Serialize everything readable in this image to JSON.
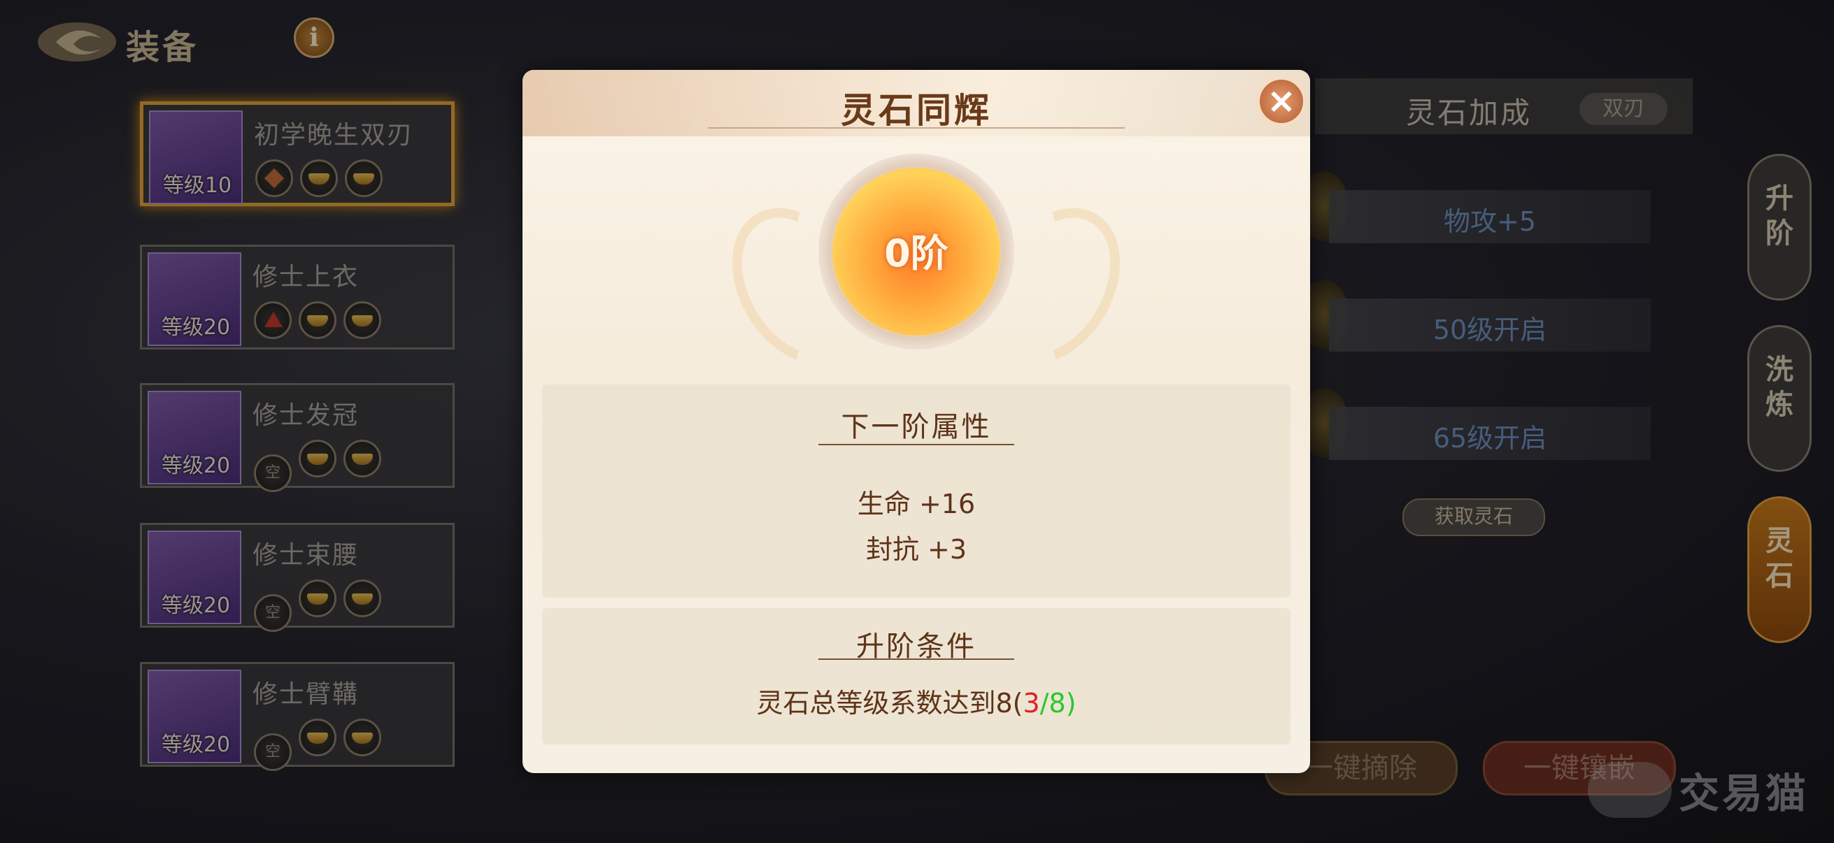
{
  "header": {
    "title": "装备",
    "info_label": "i"
  },
  "equipment": [
    {
      "name": "初学晚生双刃",
      "level": "等级10",
      "selected": true,
      "slots": [
        "diamond",
        "gold",
        "gold"
      ]
    },
    {
      "name": "修士上衣",
      "level": "等级20",
      "selected": false,
      "slots": [
        "tri",
        "gold",
        "gold"
      ]
    },
    {
      "name": "修士发冠",
      "level": "等级20",
      "selected": false,
      "slots": [
        "空",
        "gold",
        "gold"
      ]
    },
    {
      "name": "修士束腰",
      "level": "等级20",
      "selected": false,
      "slots": [
        "空",
        "gold",
        "gold"
      ]
    },
    {
      "name": "修士臂鞲",
      "level": "等级20",
      "selected": false,
      "slots": [
        "空",
        "gold",
        "gold"
      ]
    }
  ],
  "right_panel": {
    "title": "灵石加成",
    "weapon_tag": "双刃",
    "rows": [
      "物攻+5",
      "50级开启",
      "65级开启"
    ],
    "get_stone": "获取灵石",
    "remove_all": "一键摘除",
    "embed_all": "一键镶嵌"
  },
  "side_tabs": [
    {
      "label": "升\n阶",
      "active": false
    },
    {
      "label": "洗\n炼",
      "active": false
    },
    {
      "label": "灵\n石",
      "active": true
    }
  ],
  "modal": {
    "title": "灵石同辉",
    "close": "×",
    "rank": "0阶",
    "next_title": "下一阶属性",
    "attrs": [
      "生命 +16",
      "封抗 +3"
    ],
    "cond_title": "升阶条件",
    "cond_prefix": "灵石总等级系数达到8(",
    "cond_current": "3",
    "cond_sep": "/",
    "cond_target": "8",
    "cond_suffix": ")"
  },
  "watermark": "交易猫",
  "colors": {
    "accent_orange": "#ff9a30",
    "title_brown": "#6a3a18",
    "progress_red": "#e02020",
    "progress_green": "#2ac82a"
  }
}
